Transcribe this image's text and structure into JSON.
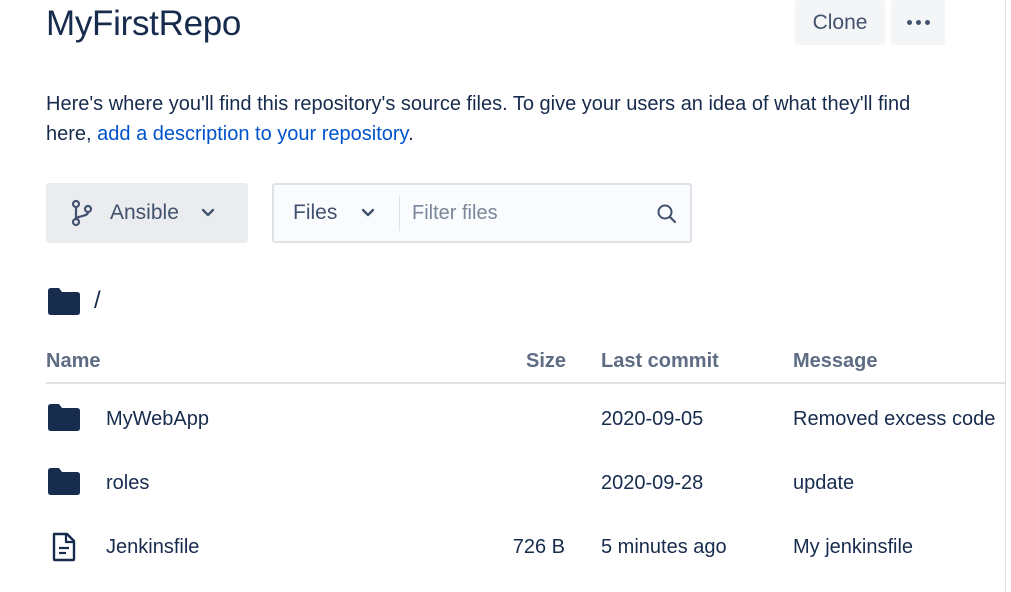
{
  "repo": {
    "title": "MyFirstRepo"
  },
  "header": {
    "clone_label": "Clone"
  },
  "description": {
    "text": "Here's where you'll find this repository's source files. To give your users an idea of what they'll find here, ",
    "link_text": "add a description to your repository",
    "suffix": "."
  },
  "branch": {
    "label": "Ansible",
    "icon": "branch-icon"
  },
  "filter": {
    "type_label": "Files",
    "placeholder": "Filter files",
    "value": ""
  },
  "path": {
    "text": "/"
  },
  "table": {
    "headers": {
      "name": "Name",
      "size": "Size",
      "last_commit": "Last commit",
      "message": "Message"
    },
    "rows": [
      {
        "type": "folder",
        "name": "MyWebApp",
        "size": "",
        "last_commit": "2020-09-05",
        "message": "Removed excess code"
      },
      {
        "type": "folder",
        "name": "roles",
        "size": "",
        "last_commit": "2020-09-28",
        "message": "update"
      },
      {
        "type": "file",
        "name": "Jenkinsfile",
        "size": "726 B",
        "last_commit": "5 minutes ago",
        "message": "My jenkinsfile"
      }
    ]
  },
  "colors": {
    "text": "#172b4d",
    "link": "#0052cc",
    "muted": "#42526e",
    "header": "#5e6c84",
    "folder": "#172b4d"
  }
}
